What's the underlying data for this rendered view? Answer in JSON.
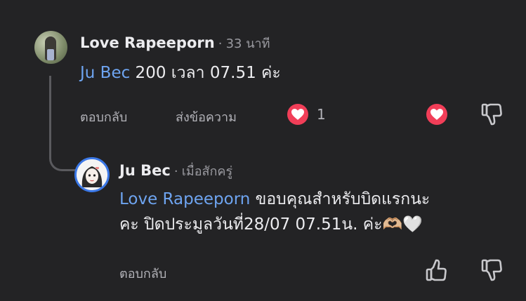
{
  "comment": {
    "author": "Love Rapeeporn",
    "separator": "·",
    "time": "33 นาที",
    "mention": "Ju Bec",
    "text": " 200 เวลา 07.51 ค่ะ",
    "actions": {
      "reply": "ตอบกลับ",
      "message": "ส่งข้อความ",
      "reaction_count": "1"
    }
  },
  "reply": {
    "author": "Ju Bec",
    "separator": "·",
    "time": "เมื่อสักครู่",
    "mention": "Love Rapeeporn",
    "text_line1": " ขอบคุณสำหรับบิดแรกนะ",
    "text_line2": "คะ ปิดประมูลวันที่28/07 07.51น. ค่ะ🫶🏼🤍",
    "actions": {
      "reply": "ตอบกลับ"
    }
  },
  "colors": {
    "background": "#232325",
    "mention": "#6ea4f0",
    "heart": "#f13e58",
    "avatar_ring": "#3b78e7"
  },
  "icons": [
    "heart-icon",
    "thumbs-up-icon",
    "thumbs-down-icon"
  ]
}
